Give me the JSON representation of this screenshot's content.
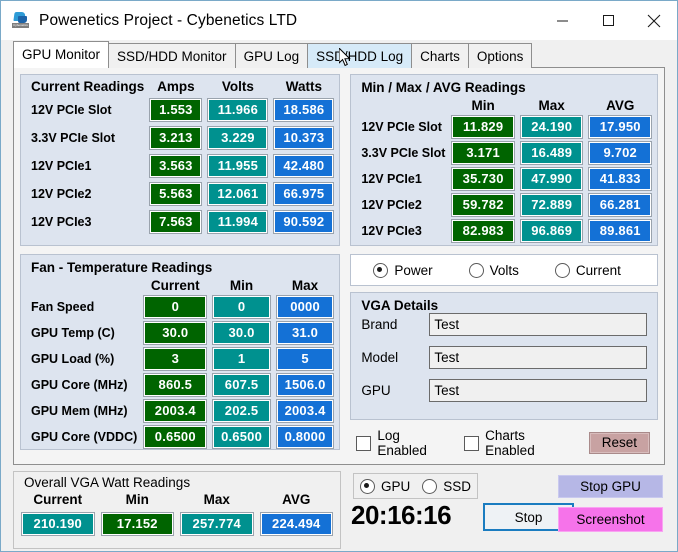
{
  "window": {
    "title": "Powenetics Project - Cybenetics LTD",
    "app_icon": "powenetics-logo-icon",
    "minimize": "—",
    "maximize": "□",
    "close": "✕"
  },
  "tabs": [
    {
      "label": "GPU Monitor",
      "state": "active"
    },
    {
      "label": "SSD/HDD Monitor",
      "state": "normal"
    },
    {
      "label": "GPU Log",
      "state": "normal"
    },
    {
      "label": "SSD/HDD Log",
      "state": "hover"
    },
    {
      "label": "Charts",
      "state": "normal"
    },
    {
      "label": "Options",
      "state": "normal"
    }
  ],
  "current_readings": {
    "title": "Current Readings",
    "columns": [
      "Amps",
      "Volts",
      "Watts"
    ],
    "rows": [
      {
        "label": "12V PCIe Slot",
        "amps": "1.553",
        "volts": "11.966",
        "watts": "18.586"
      },
      {
        "label": "3.3V PCIe Slot",
        "amps": "3.213",
        "volts": "3.229",
        "watts": "10.373"
      },
      {
        "label": "12V PCIe1",
        "amps": "3.563",
        "volts": "11.955",
        "watts": "42.480"
      },
      {
        "label": "12V PCIe2",
        "amps": "5.563",
        "volts": "12.061",
        "watts": "66.975"
      },
      {
        "label": "12V PCIe3",
        "amps": "7.563",
        "volts": "11.994",
        "watts": "90.592"
      }
    ]
  },
  "minmaxavg_readings": {
    "title": "Min / Max / AVG Readings",
    "columns": [
      "Min",
      "Max",
      "AVG"
    ],
    "rows": [
      {
        "label": "12V PCIe Slot",
        "min": "11.829",
        "max": "24.190",
        "avg": "17.950"
      },
      {
        "label": "3.3V PCIe Slot",
        "min": "3.171",
        "max": "16.489",
        "avg": "9.702"
      },
      {
        "label": "12V PCIe1",
        "min": "35.730",
        "max": "47.990",
        "avg": "41.833"
      },
      {
        "label": "12V PCIe2",
        "min": "59.782",
        "max": "72.889",
        "avg": "66.281"
      },
      {
        "label": "12V PCIe3",
        "min": "82.983",
        "max": "96.869",
        "avg": "89.861"
      }
    ]
  },
  "fan_temp_readings": {
    "title": "Fan - Temperature Readings",
    "columns": [
      "Current",
      "Min",
      "Max"
    ],
    "rows": [
      {
        "label": "Fan Speed",
        "current": "0",
        "min": "0",
        "max": "0000"
      },
      {
        "label": "GPU Temp (C)",
        "current": "30.0",
        "min": "30.0",
        "max": "31.0"
      },
      {
        "label": "GPU Load (%)",
        "current": "3",
        "min": "1",
        "max": "5"
      },
      {
        "label": "GPU Core (MHz)",
        "current": "860.5",
        "min": "607.5",
        "max": "1506.0"
      },
      {
        "label": "GPU Mem (MHz)",
        "current": "2003.4",
        "min": "202.5",
        "max": "2003.4"
      },
      {
        "label": "GPU Core (VDDC)",
        "current": "0.6500",
        "min": "0.6500",
        "max": "0.8000"
      }
    ]
  },
  "mode_radios": {
    "options": [
      "Power",
      "Volts",
      "Current"
    ],
    "selected": "Power"
  },
  "vga_details": {
    "title": "VGA Details",
    "fields": [
      {
        "label": "Brand",
        "value": "Test"
      },
      {
        "label": "Model",
        "value": "Test"
      },
      {
        "label": "GPU",
        "value": "Test"
      }
    ]
  },
  "options_row": {
    "log_enabled": {
      "label": "Log Enabled",
      "checked": false
    },
    "charts_enabled": {
      "label": "Charts Enabled",
      "checked": false
    },
    "reset_label": "Reset"
  },
  "overall_watts": {
    "title": "Overall VGA Watt Readings",
    "columns": [
      "Current",
      "Min",
      "Max",
      "AVG"
    ],
    "values": [
      "210.190",
      "17.152",
      "257.774",
      "224.494"
    ]
  },
  "device_radios": {
    "options": [
      "GPU",
      "SSD"
    ],
    "selected": "GPU"
  },
  "status": {
    "clock": "20:16:16",
    "stop_label": "Stop",
    "stop_gpu_label": "Stop GPU",
    "screenshot_label": "Screenshot"
  },
  "colors": {
    "green": "#006400",
    "teal": "#00918f",
    "blue": "#1471d6",
    "panel": "#dde4ef",
    "reset": "#c8a2a2",
    "stop_gpu": "#b6b7e6",
    "screenshot": "#f673ea",
    "tab_hover": "#d6eaf8"
  }
}
